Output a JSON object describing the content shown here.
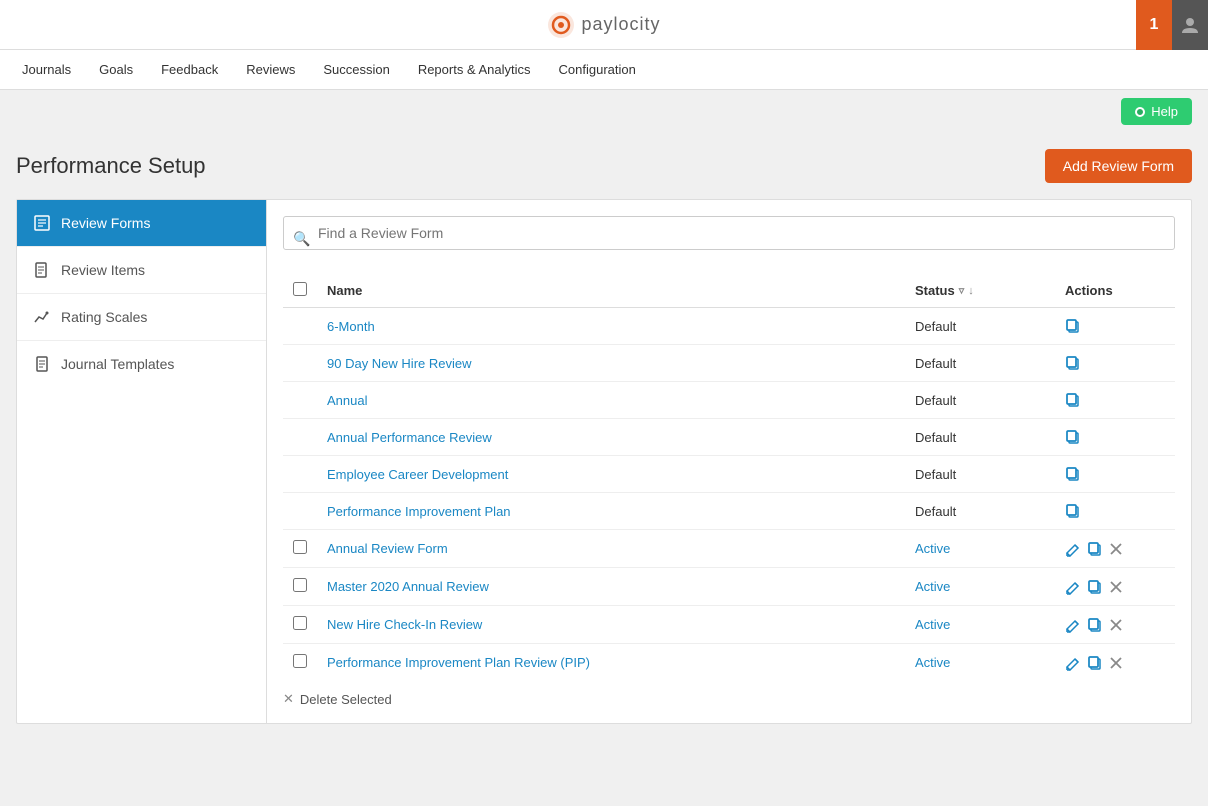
{
  "topbar": {
    "logo_text": "paylocity",
    "notification_count": "1"
  },
  "navbar": {
    "items": [
      {
        "label": "Journals",
        "id": "journals"
      },
      {
        "label": "Goals",
        "id": "goals"
      },
      {
        "label": "Feedback",
        "id": "feedback"
      },
      {
        "label": "Reviews",
        "id": "reviews"
      },
      {
        "label": "Succession",
        "id": "succession"
      },
      {
        "label": "Reports & Analytics",
        "id": "reports"
      },
      {
        "label": "Configuration",
        "id": "configuration"
      }
    ]
  },
  "help": {
    "button_label": "Help"
  },
  "page": {
    "title": "Performance Setup",
    "add_button_label": "Add Review Form"
  },
  "sidebar": {
    "items": [
      {
        "id": "review-forms",
        "label": "Review Forms",
        "icon": "form"
      },
      {
        "id": "review-items",
        "label": "Review Items",
        "icon": "document"
      },
      {
        "id": "rating-scales",
        "label": "Rating Scales",
        "icon": "chart"
      },
      {
        "id": "journal-templates",
        "label": "Journal Templates",
        "icon": "journal"
      }
    ]
  },
  "search": {
    "placeholder": "Find a Review Form"
  },
  "table": {
    "columns": {
      "name": "Name",
      "status": "Status",
      "actions": "Actions"
    },
    "rows": [
      {
        "id": 1,
        "name": "6-Month",
        "status": "Default",
        "status_type": "default",
        "has_checkbox": false
      },
      {
        "id": 2,
        "name": "90 Day New Hire Review",
        "status": "Default",
        "status_type": "default",
        "has_checkbox": false
      },
      {
        "id": 3,
        "name": "Annual",
        "status": "Default",
        "status_type": "default",
        "has_checkbox": false
      },
      {
        "id": 4,
        "name": "Annual Performance Review",
        "status": "Default",
        "status_type": "default",
        "has_checkbox": false
      },
      {
        "id": 5,
        "name": "Employee Career Development",
        "status": "Default",
        "status_type": "default",
        "has_checkbox": false
      },
      {
        "id": 6,
        "name": "Performance Improvement Plan",
        "status": "Default",
        "status_type": "default",
        "has_checkbox": false
      },
      {
        "id": 7,
        "name": "Annual Review Form",
        "status": "Active",
        "status_type": "active",
        "has_checkbox": true
      },
      {
        "id": 8,
        "name": "Master 2020 Annual Review",
        "status": "Active",
        "status_type": "active",
        "has_checkbox": true
      },
      {
        "id": 9,
        "name": "New Hire Check-In Review",
        "status": "Active",
        "status_type": "active",
        "has_checkbox": true
      },
      {
        "id": 10,
        "name": "Performance Improvement Plan Review (PIP)",
        "status": "Active",
        "status_type": "active",
        "has_checkbox": true
      }
    ],
    "delete_selected_label": "Delete Selected"
  },
  "colors": {
    "primary": "#1a87c4",
    "accent": "#e05a1e",
    "active_sidebar": "#1a87c4"
  }
}
